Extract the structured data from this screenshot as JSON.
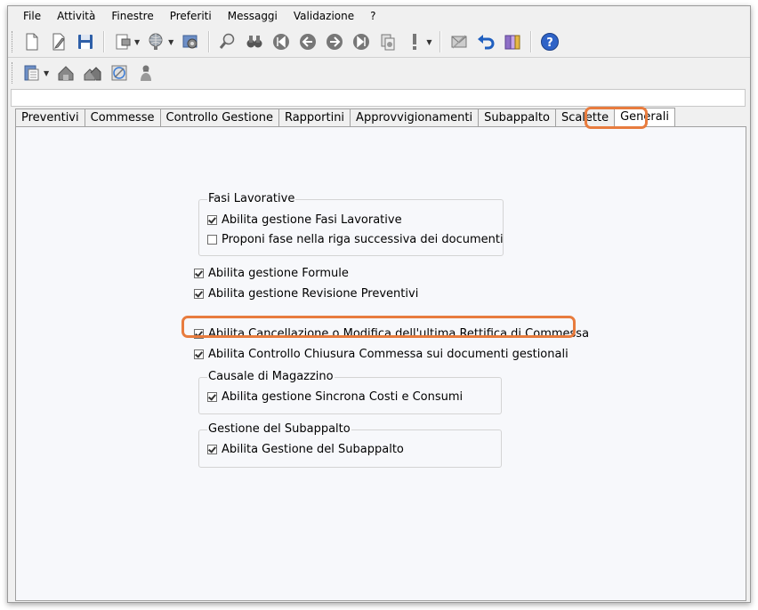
{
  "menu": [
    "File",
    "Attività",
    "Finestre",
    "Preferiti",
    "Messaggi",
    "Validazione",
    "?"
  ],
  "tabs": [
    {
      "label": "Preventivi",
      "active": false
    },
    {
      "label": "Commesse",
      "active": false
    },
    {
      "label": "Controllo Gestione",
      "active": false
    },
    {
      "label": "Rapportini",
      "active": false
    },
    {
      "label": "Approvvigionamenti",
      "active": false
    },
    {
      "label": "Subappalto",
      "active": false
    },
    {
      "label": "Scalette",
      "active": false
    },
    {
      "label": "Generali",
      "active": true
    }
  ],
  "groups": {
    "fasi": {
      "title": "Fasi Lavorative",
      "items": [
        {
          "label": "Abilita gestione Fasi Lavorative",
          "checked": true
        },
        {
          "label": "Proponi fase nella riga successiva dei documenti",
          "checked": false
        }
      ]
    },
    "causale": {
      "title": "Causale di Magazzino",
      "items": [
        {
          "label": "Abilita gestione Sincrona Costi e Consumi",
          "checked": true
        }
      ]
    },
    "subappalto": {
      "title": "Gestione del Subappalto",
      "items": [
        {
          "label": "Abilita Gestione del Subappalto",
          "checked": true
        }
      ]
    }
  },
  "options": [
    {
      "label": "Abilita gestione Formule",
      "checked": true
    },
    {
      "label": "Abilita gestione Revisione Preventivi",
      "checked": true
    },
    {
      "label": "Abilita Cancellazione o Modifica dell'ultima Rettifica di Commessa",
      "checked": true
    },
    {
      "label": "Abilita Controllo Chiusura Commessa sui documenti gestionali",
      "checked": true
    }
  ],
  "colors": {
    "highlight": "#e87c3e",
    "panel": "#f7f8fb",
    "chrome": "#f0f0f0"
  },
  "toolbar_icons": [
    "new-document-icon",
    "edit-document-icon",
    "save-icon",
    "print-icon",
    "globe-icon",
    "settings-icon",
    "search-icon",
    "binoculars-icon",
    "first-icon",
    "previous-icon",
    "next-icon",
    "last-icon",
    "copy-icon",
    "exclamation-icon",
    "envelope-icon",
    "undo-icon",
    "package-icon",
    "help-icon"
  ]
}
